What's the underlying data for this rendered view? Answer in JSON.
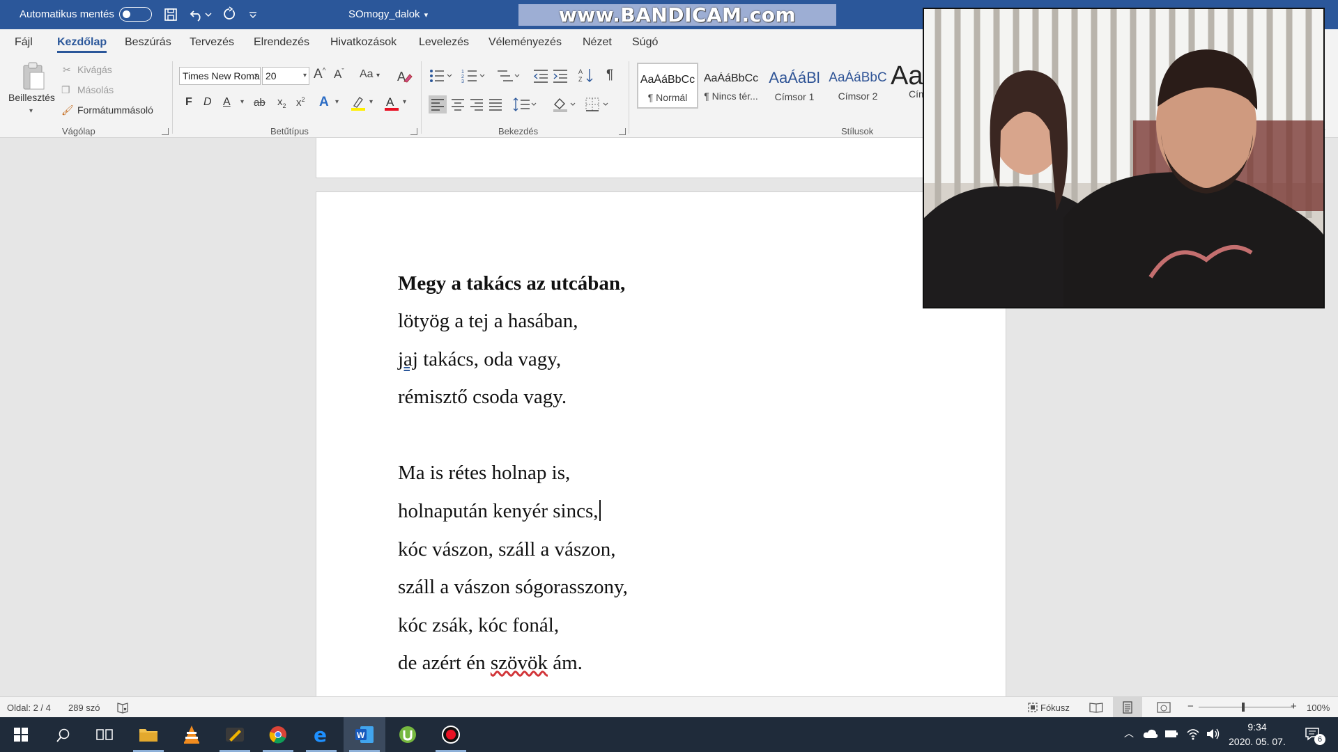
{
  "titlebar": {
    "autosave_label": "Automatikus mentés",
    "doc_title": "SOmogy_dalok",
    "overlay_watermark": "www.BANDICAM.com"
  },
  "tabs": [
    "Fájl",
    "Kezdőlap",
    "Beszúrás",
    "Tervezés",
    "Elrendezés",
    "Hivatkozások",
    "Levelezés",
    "Véleményezés",
    "Nézet",
    "Súgó"
  ],
  "active_tab": "Kezdőlap",
  "ribbon": {
    "clipboard": {
      "paste": "Beillesztés",
      "cut": "Kivágás",
      "copy": "Másolás",
      "format_painter": "Formátummásoló",
      "label": "Vágólap"
    },
    "font": {
      "font_name": "Times New Roman",
      "font_size": "20",
      "label": "Betűtípus",
      "case_label": "Aa",
      "bold_label": "F",
      "italic_label": "D",
      "underline_label": "A",
      "strike_label": "ab",
      "text_effects_label": "A",
      "font_color_label": "A"
    },
    "paragraph": {
      "label": "Bekezdés",
      "show_marks_label": "¶"
    },
    "styles": {
      "label": "Stílusok",
      "items": [
        {
          "sample": "AaÁáBbCc",
          "name": "¶ Normál"
        },
        {
          "sample": "AaÁáBbCc",
          "name": "¶ Nincs tér..."
        },
        {
          "sample": "AaÁáBl",
          "name": "Címsor 1"
        },
        {
          "sample": "AaÁáBbC",
          "name": "Címsor 2"
        },
        {
          "sample": "Aa",
          "name": "Cím"
        }
      ]
    }
  },
  "document": {
    "lines": [
      {
        "text": "Megy a takács az utcában,"
      },
      {
        "text": "lötyög a tej a hasában,"
      },
      {
        "pre": "jaj",
        "text": " takács, oda vagy,"
      },
      {
        "text": "rémisztő csoda vagy."
      },
      {
        "text": "Ma is rétes holnap is,"
      },
      {
        "text": "holnapután kenyér sincs,"
      },
      {
        "text": "kóc vászon, száll a vászon,"
      },
      {
        "text": "száll a vászon sógorasszony,"
      },
      {
        "text": "kóc zsák, kóc fonál,"
      },
      {
        "pre": "de azért én ",
        "mid": "szövök",
        "text": " ám."
      }
    ]
  },
  "statusbar": {
    "page": "Oldal: 2 / 4",
    "words": "289 szó",
    "focus": "Fókusz",
    "zoom": "100%",
    "zoom_minus": "−",
    "zoom_plus": "+"
  },
  "taskbar": {
    "time": "9:34",
    "date": "2020. 05. 07.",
    "notifications": "6"
  },
  "colors": {
    "word_blue": "#2b579a",
    "taskbar": "#1f2b3a",
    "spell_error": "#d13438"
  }
}
